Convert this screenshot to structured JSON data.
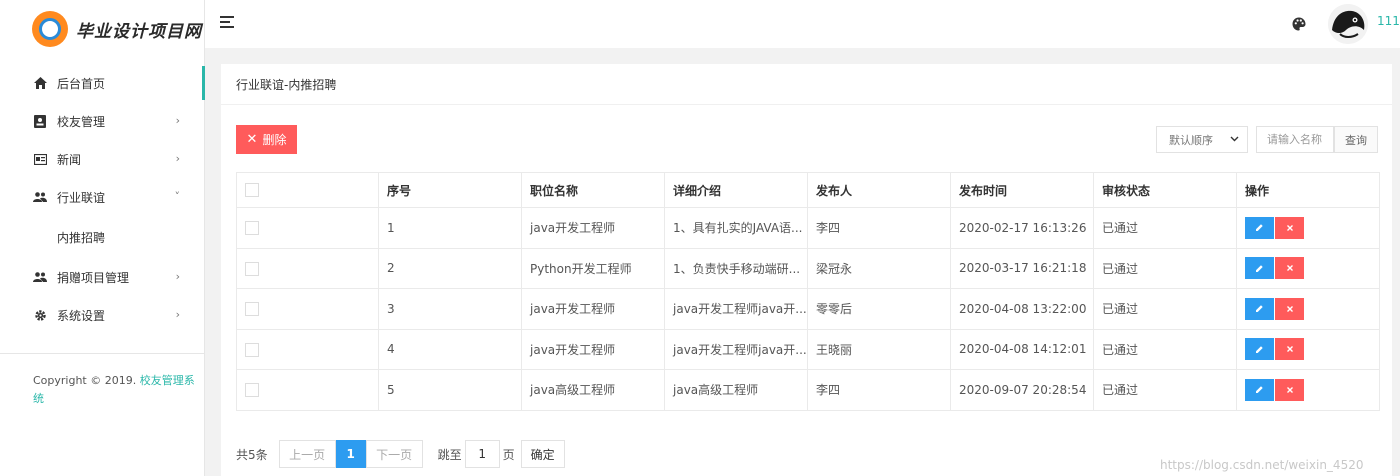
{
  "brand": {
    "logo_text": "毕业设计项目网"
  },
  "sidebar": {
    "items": [
      {
        "label": "后台首页",
        "icon": "home-icon",
        "arrow": ""
      },
      {
        "label": "校友管理",
        "icon": "id-card-icon",
        "arrow": "›"
      },
      {
        "label": "新闻",
        "icon": "news-icon",
        "arrow": "›"
      },
      {
        "label": "行业联谊",
        "icon": "users-icon",
        "arrow": "˅"
      },
      {
        "label": "内推招聘",
        "icon": "",
        "arrow": ""
      },
      {
        "label": "捐赠项目管理",
        "icon": "users-icon",
        "arrow": "›"
      },
      {
        "label": "系统设置",
        "icon": "gear-icon",
        "arrow": "›"
      }
    ],
    "copyright_prefix": "Copyright © 2019.",
    "copyright_brand": "校友管理系统"
  },
  "header": {
    "username": "111",
    "menu_icon": "hamburger-icon",
    "theme_icon": "palette-icon"
  },
  "page": {
    "title": "行业联谊-内推招聘",
    "delete_label": "删除",
    "sort_value": "默认顺序",
    "search_placeholder": "请输入名称",
    "search_label": "查询"
  },
  "table": {
    "headers": [
      "",
      "序号",
      "职位名称",
      "详细介绍",
      "发布人",
      "发布时间",
      "审核状态",
      "操作"
    ],
    "rows": [
      {
        "no": "1",
        "title": "java开发工程师",
        "desc": "1、具有扎实的JAVA语...",
        "publisher": "李四",
        "time": "2020-02-17 16:13:26",
        "status": "已通过"
      },
      {
        "no": "2",
        "title": "Python开发工程师",
        "desc": "1、负责快手移动端研...",
        "publisher": "梁冠永",
        "time": "2020-03-17 16:21:18",
        "status": "已通过"
      },
      {
        "no": "3",
        "title": "java开发工程师",
        "desc": "java开发工程师java开...",
        "publisher": "零零后",
        "time": "2020-04-08 13:22:00",
        "status": "已通过"
      },
      {
        "no": "4",
        "title": "java开发工程师",
        "desc": "java开发工程师java开...",
        "publisher": "王晓丽",
        "time": "2020-04-08 14:12:01",
        "status": "已通过"
      },
      {
        "no": "5",
        "title": "java高级工程师",
        "desc": "java高级工程师",
        "publisher": "李四",
        "time": "2020-09-07 20:28:54",
        "status": "已通过"
      }
    ]
  },
  "pager": {
    "total": "共5条",
    "prev": "上一页",
    "current": "1",
    "next": "下一页",
    "jump": "跳至",
    "jump_value": "1",
    "page_unit": "页",
    "ok": "确定"
  },
  "watermark": "https://blog.csdn.net/weixin_4520",
  "colors": {
    "accent": "#2ab7a9",
    "danger": "#ff5b5b",
    "primary": "#2d9cf0"
  }
}
